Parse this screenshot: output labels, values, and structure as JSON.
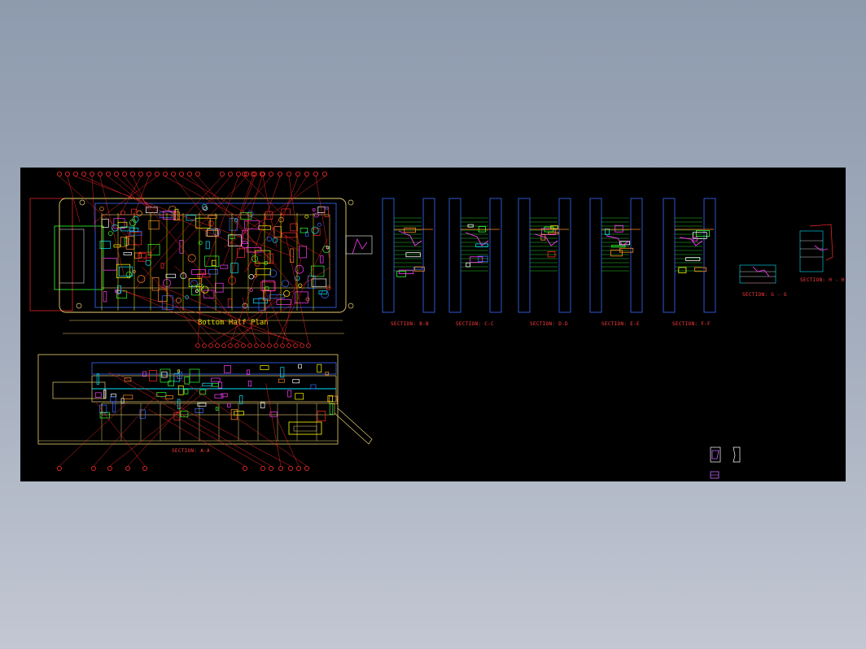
{
  "view": {
    "background_gradient": [
      "#8e9bae",
      "#c3c7d3"
    ],
    "canvas_background": "#000000"
  },
  "drawing": {
    "plan_title": "Bottom Half Plan",
    "section_labels": {
      "aa": "SECTION: A-A",
      "bb": "SECTION: B-B",
      "cc": "SECTION: C-C",
      "dd": "SECTION: D-D",
      "ee": "SECTION: E-E",
      "ff": "SECTION: F-F",
      "gg": "SECTION: G - G",
      "hh": "SECTION: H - H"
    }
  },
  "colors": {
    "outline": "#e8d070",
    "callout": "#ff2a2a",
    "cyan": "#00e5ff",
    "blue": "#3a6cff",
    "magenta": "#ff3cff",
    "green": "#30ff30",
    "yellow": "#ffff00",
    "orange": "#ff8a2a",
    "white": "#ffffff"
  }
}
